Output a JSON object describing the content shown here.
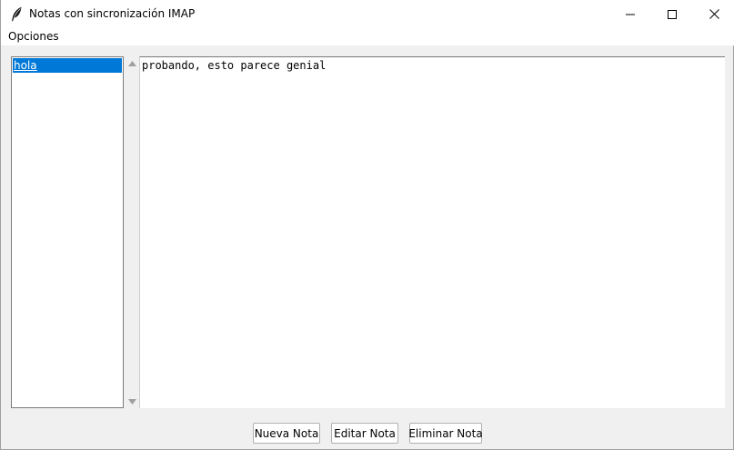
{
  "window": {
    "title": "Notas con sincronización IMAP",
    "icon": "feather-icon"
  },
  "menubar": {
    "items": [
      {
        "label": "Opciones"
      }
    ]
  },
  "notes_list": {
    "items": [
      {
        "label": "hola",
        "selected": true
      }
    ]
  },
  "editor": {
    "content": "probando, esto parece genial"
  },
  "buttons": {
    "new_note": "Nueva Nota",
    "edit_note": "Editar Nota",
    "delete_note": "Eliminar Nota"
  },
  "colors": {
    "selection": "#0078d7",
    "window_bg": "#f0f0f0"
  }
}
